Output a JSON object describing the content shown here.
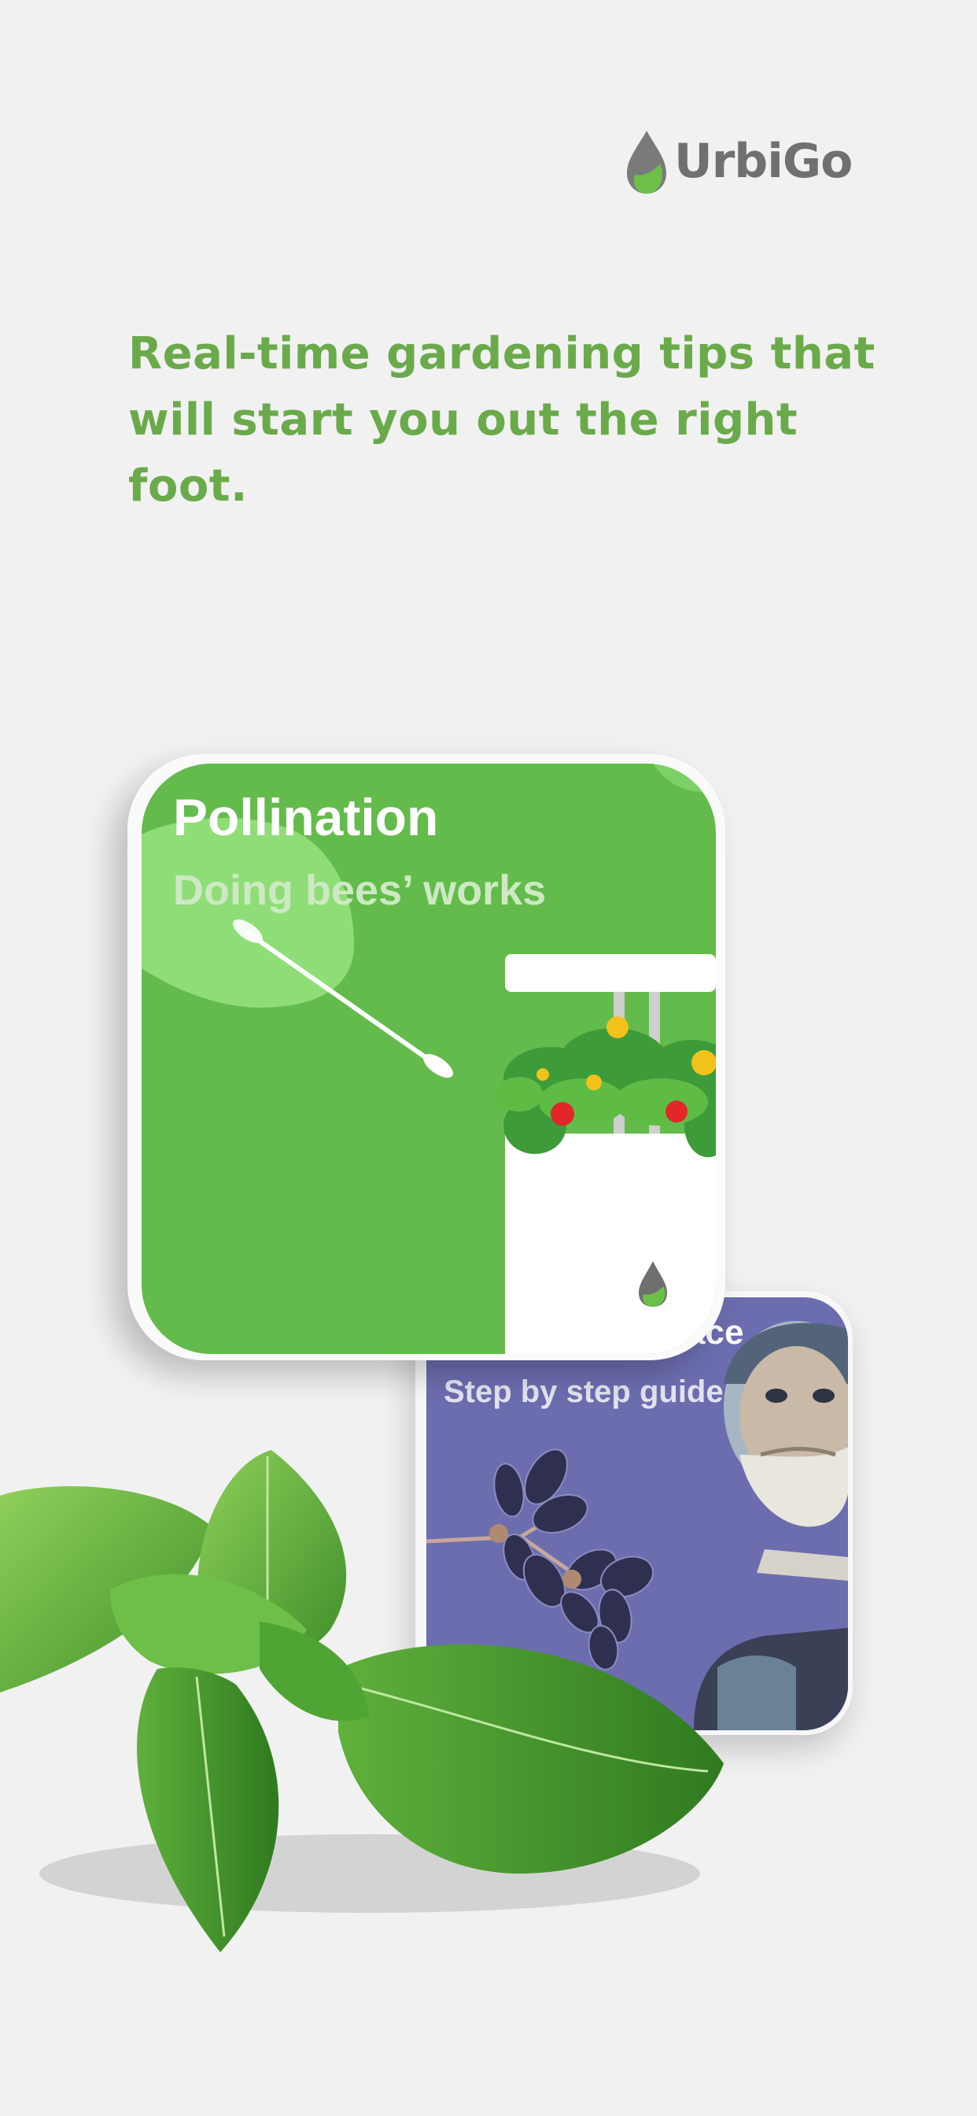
{
  "brand": {
    "name": "UrbiGo"
  },
  "headline": {
    "line1": "Real-time gardening tips that",
    "line2": "will start you out the right foot."
  },
  "cards": {
    "pollination": {
      "title": "Pollination",
      "subtitle": "Doing bees’ works"
    },
    "guide": {
      "title_fragment": "ace",
      "subtitle": "Step by step guide"
    }
  },
  "icons": {
    "logo": "leaf-drop-icon",
    "planter": "planter-drop-icon"
  },
  "colors": {
    "background": "#f1f1f1",
    "brand_green": "#6aaa4a",
    "card_green": "#63bb4b",
    "card_purple": "#6c6daf",
    "logo_gray": "#707070"
  }
}
